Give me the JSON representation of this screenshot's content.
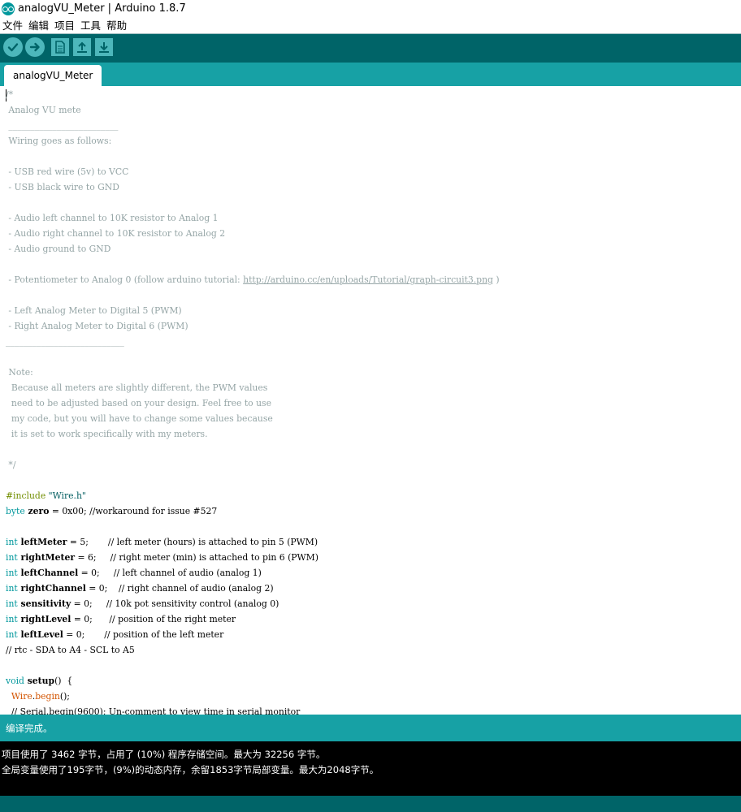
{
  "window": {
    "title": "analogVU_Meter | Arduino 1.8.7"
  },
  "menu": [
    "文件",
    "编辑",
    "项目",
    "工具",
    "帮助"
  ],
  "toolbar": {
    "buttons": [
      {
        "name": "verify",
        "icon": "checkmark-icon"
      },
      {
        "name": "upload",
        "icon": "arrow-right-icon"
      },
      {
        "name": "new",
        "icon": "new-file-icon"
      },
      {
        "name": "open",
        "icon": "open-up-arrow-icon"
      },
      {
        "name": "save",
        "icon": "save-down-arrow-icon"
      }
    ]
  },
  "tab": {
    "label": "analogVU_Meter"
  },
  "editor": {
    "lines": [
      [
        [
          "comment",
          "/*"
        ]
      ],
      [
        [
          "comment",
          " Analog VU mete"
        ]
      ],
      [
        [
          "comment",
          " _________________________"
        ]
      ],
      [
        [
          "comment",
          " Wiring goes as follows:"
        ]
      ],
      [
        [
          "comment",
          ""
        ]
      ],
      [
        [
          "comment",
          " - USB red wire (5v) to VCC"
        ]
      ],
      [
        [
          "comment",
          " - USB black wire to GND"
        ]
      ],
      [
        [
          "comment",
          ""
        ]
      ],
      [
        [
          "comment",
          " - Audio left channel to 10K resistor to Analog 1"
        ]
      ],
      [
        [
          "comment",
          " - Audio right channel to 10K resistor to Analog 2"
        ]
      ],
      [
        [
          "comment",
          " - Audio ground to GND"
        ]
      ],
      [
        [
          "comment",
          ""
        ]
      ],
      [
        [
          "comment",
          " - Potentiometer to Analog 0 (follow arduino tutorial: "
        ],
        [
          "link",
          "http://arduino.cc/en/uploads/Tutorial/graph-circuit3.png"
        ],
        [
          "comment",
          " )"
        ]
      ],
      [
        [
          "comment",
          ""
        ]
      ],
      [
        [
          "comment",
          " - Left Analog Meter to Digital 5 (PWM)"
        ]
      ],
      [
        [
          "comment",
          " - Right Analog Meter to Digital 6 (PWM)"
        ]
      ],
      [
        [
          "comment",
          "___________________________"
        ]
      ],
      [
        [
          "comment",
          ""
        ]
      ],
      [
        [
          "comment",
          " Note:"
        ]
      ],
      [
        [
          "comment",
          "  Because all meters are slightly different, the PWM values"
        ]
      ],
      [
        [
          "comment",
          "  need to be adjusted based on your design. Feel free to use"
        ]
      ],
      [
        [
          "comment",
          "  my code, but you will have to change some values because"
        ]
      ],
      [
        [
          "comment",
          "  it is set to work specifically with my meters."
        ]
      ],
      [
        [
          "comment",
          ""
        ]
      ],
      [
        [
          "comment",
          " */"
        ]
      ],
      [
        [
          "plain",
          ""
        ]
      ],
      [
        [
          "pre",
          "#include "
        ],
        [
          "str",
          "\"Wire.h\""
        ]
      ],
      [
        [
          "kw",
          "byte"
        ],
        [
          "bold",
          " zero"
        ],
        [
          "plain",
          " = 0x00; //workaround for issue #527"
        ]
      ],
      [
        [
          "plain",
          ""
        ]
      ],
      [
        [
          "kw",
          "int"
        ],
        [
          "bold",
          " leftMeter"
        ],
        [
          "plain",
          " = 5;       // left meter (hours) is attached to pin 5 (PWM)"
        ]
      ],
      [
        [
          "kw",
          "int"
        ],
        [
          "bold",
          " rightMeter"
        ],
        [
          "plain",
          " = 6;     // right meter (min) is attached to pin 6 (PWM)"
        ]
      ],
      [
        [
          "kw",
          "int"
        ],
        [
          "bold",
          " leftChannel"
        ],
        [
          "plain",
          " = 0;     // left channel of audio (analog 1)"
        ]
      ],
      [
        [
          "kw",
          "int"
        ],
        [
          "bold",
          " rightChannel"
        ],
        [
          "plain",
          " = 0;    // right channel of audio (analog 2)"
        ]
      ],
      [
        [
          "kw",
          "int"
        ],
        [
          "bold",
          " sensitivity"
        ],
        [
          "plain",
          " = 0;     // 10k pot sensitivity control (analog 0)"
        ]
      ],
      [
        [
          "kw",
          "int"
        ],
        [
          "bold",
          " rightLevel"
        ],
        [
          "plain",
          " = 0;      // position of the right meter"
        ]
      ],
      [
        [
          "kw",
          "int"
        ],
        [
          "bold",
          " leftLevel"
        ],
        [
          "plain",
          " = 0;       // position of the left meter"
        ]
      ],
      [
        [
          "plain",
          "// rtc - SDA to A4 - SCL to A5"
        ]
      ],
      [
        [
          "plain",
          ""
        ]
      ],
      [
        [
          "kw",
          "void"
        ],
        [
          "bold",
          " setup"
        ],
        [
          "plain",
          "()  {"
        ]
      ],
      [
        [
          "plain",
          "  "
        ],
        [
          "fn",
          "Wire"
        ],
        [
          "plain",
          "."
        ],
        [
          "fn",
          "begin"
        ],
        [
          "plain",
          "();"
        ]
      ],
      [
        [
          "plain",
          "  // Serial.begin(9600); Un-comment to view time in serial monitor"
        ]
      ]
    ]
  },
  "status": {
    "message": "编译完成。"
  },
  "console": {
    "lines": [
      "项目使用了 3462 字节，占用了 (10%) 程序存储空间。最大为 32256 字节。",
      "全局变量使用了195字节，(9%)的动态内存，余留1853字节局部变量。最大为2048字节。"
    ]
  }
}
